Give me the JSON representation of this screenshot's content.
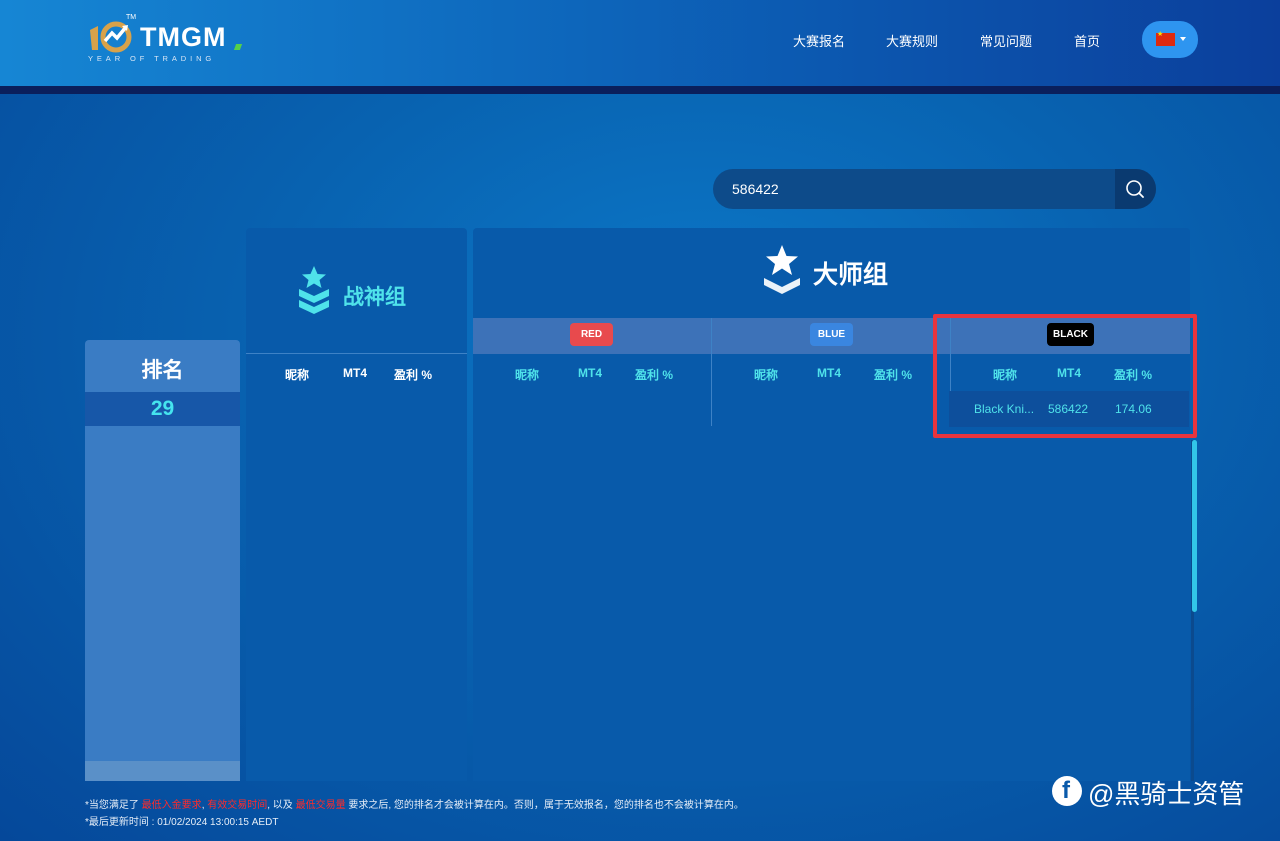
{
  "header": {
    "logo_text": "TMGM",
    "logo_tm": "TM",
    "logo_subtitle": "YEAR OF TRADING",
    "nav": [
      "大赛报名",
      "大赛规则",
      "常见问题",
      "首页"
    ],
    "language_icon": "china-flag-icon"
  },
  "search": {
    "value": "586422",
    "icon": "search-icon"
  },
  "rank": {
    "title": "排名",
    "value": "29"
  },
  "ares_group": {
    "title": "战神组",
    "columns": [
      "昵称",
      "MT4",
      "盈利 %"
    ]
  },
  "master_group": {
    "title": "大师组",
    "teams": [
      {
        "label": "RED",
        "color": "#e84a4d",
        "columns": [
          "昵称",
          "MT4",
          "盈利 %"
        ],
        "rows": []
      },
      {
        "label": "BLUE",
        "color": "#3a86e0",
        "columns": [
          "昵称",
          "MT4",
          "盈利 %"
        ],
        "rows": []
      },
      {
        "label": "BLACK",
        "color": "#000000",
        "columns": [
          "昵称",
          "MT4",
          "盈利 %"
        ],
        "rows": [
          {
            "nickname": "Black Kni...",
            "mt4": "586422",
            "profit": "174.06"
          }
        ]
      }
    ]
  },
  "footer": {
    "line1_prefix": "*当您满足了",
    "req1": "最低入金要求",
    "sep1": ",",
    "req2": "有效交易时间",
    "sep2": ", 以及",
    "req3": "最低交易量",
    "line1_suffix": "要求之后, 您的排名才会被计算在内。否则，属于无效报名，您的排名也不会被计算在内。",
    "line2": "*最后更新时间 : 01/02/2024 13:00:15 AEDT"
  },
  "watermark": {
    "text": "@黑骑士资管"
  },
  "colors": {
    "accent_cyan": "#4fe2ea",
    "highlight_red": "#e8343e",
    "panel": "#085aaa"
  }
}
